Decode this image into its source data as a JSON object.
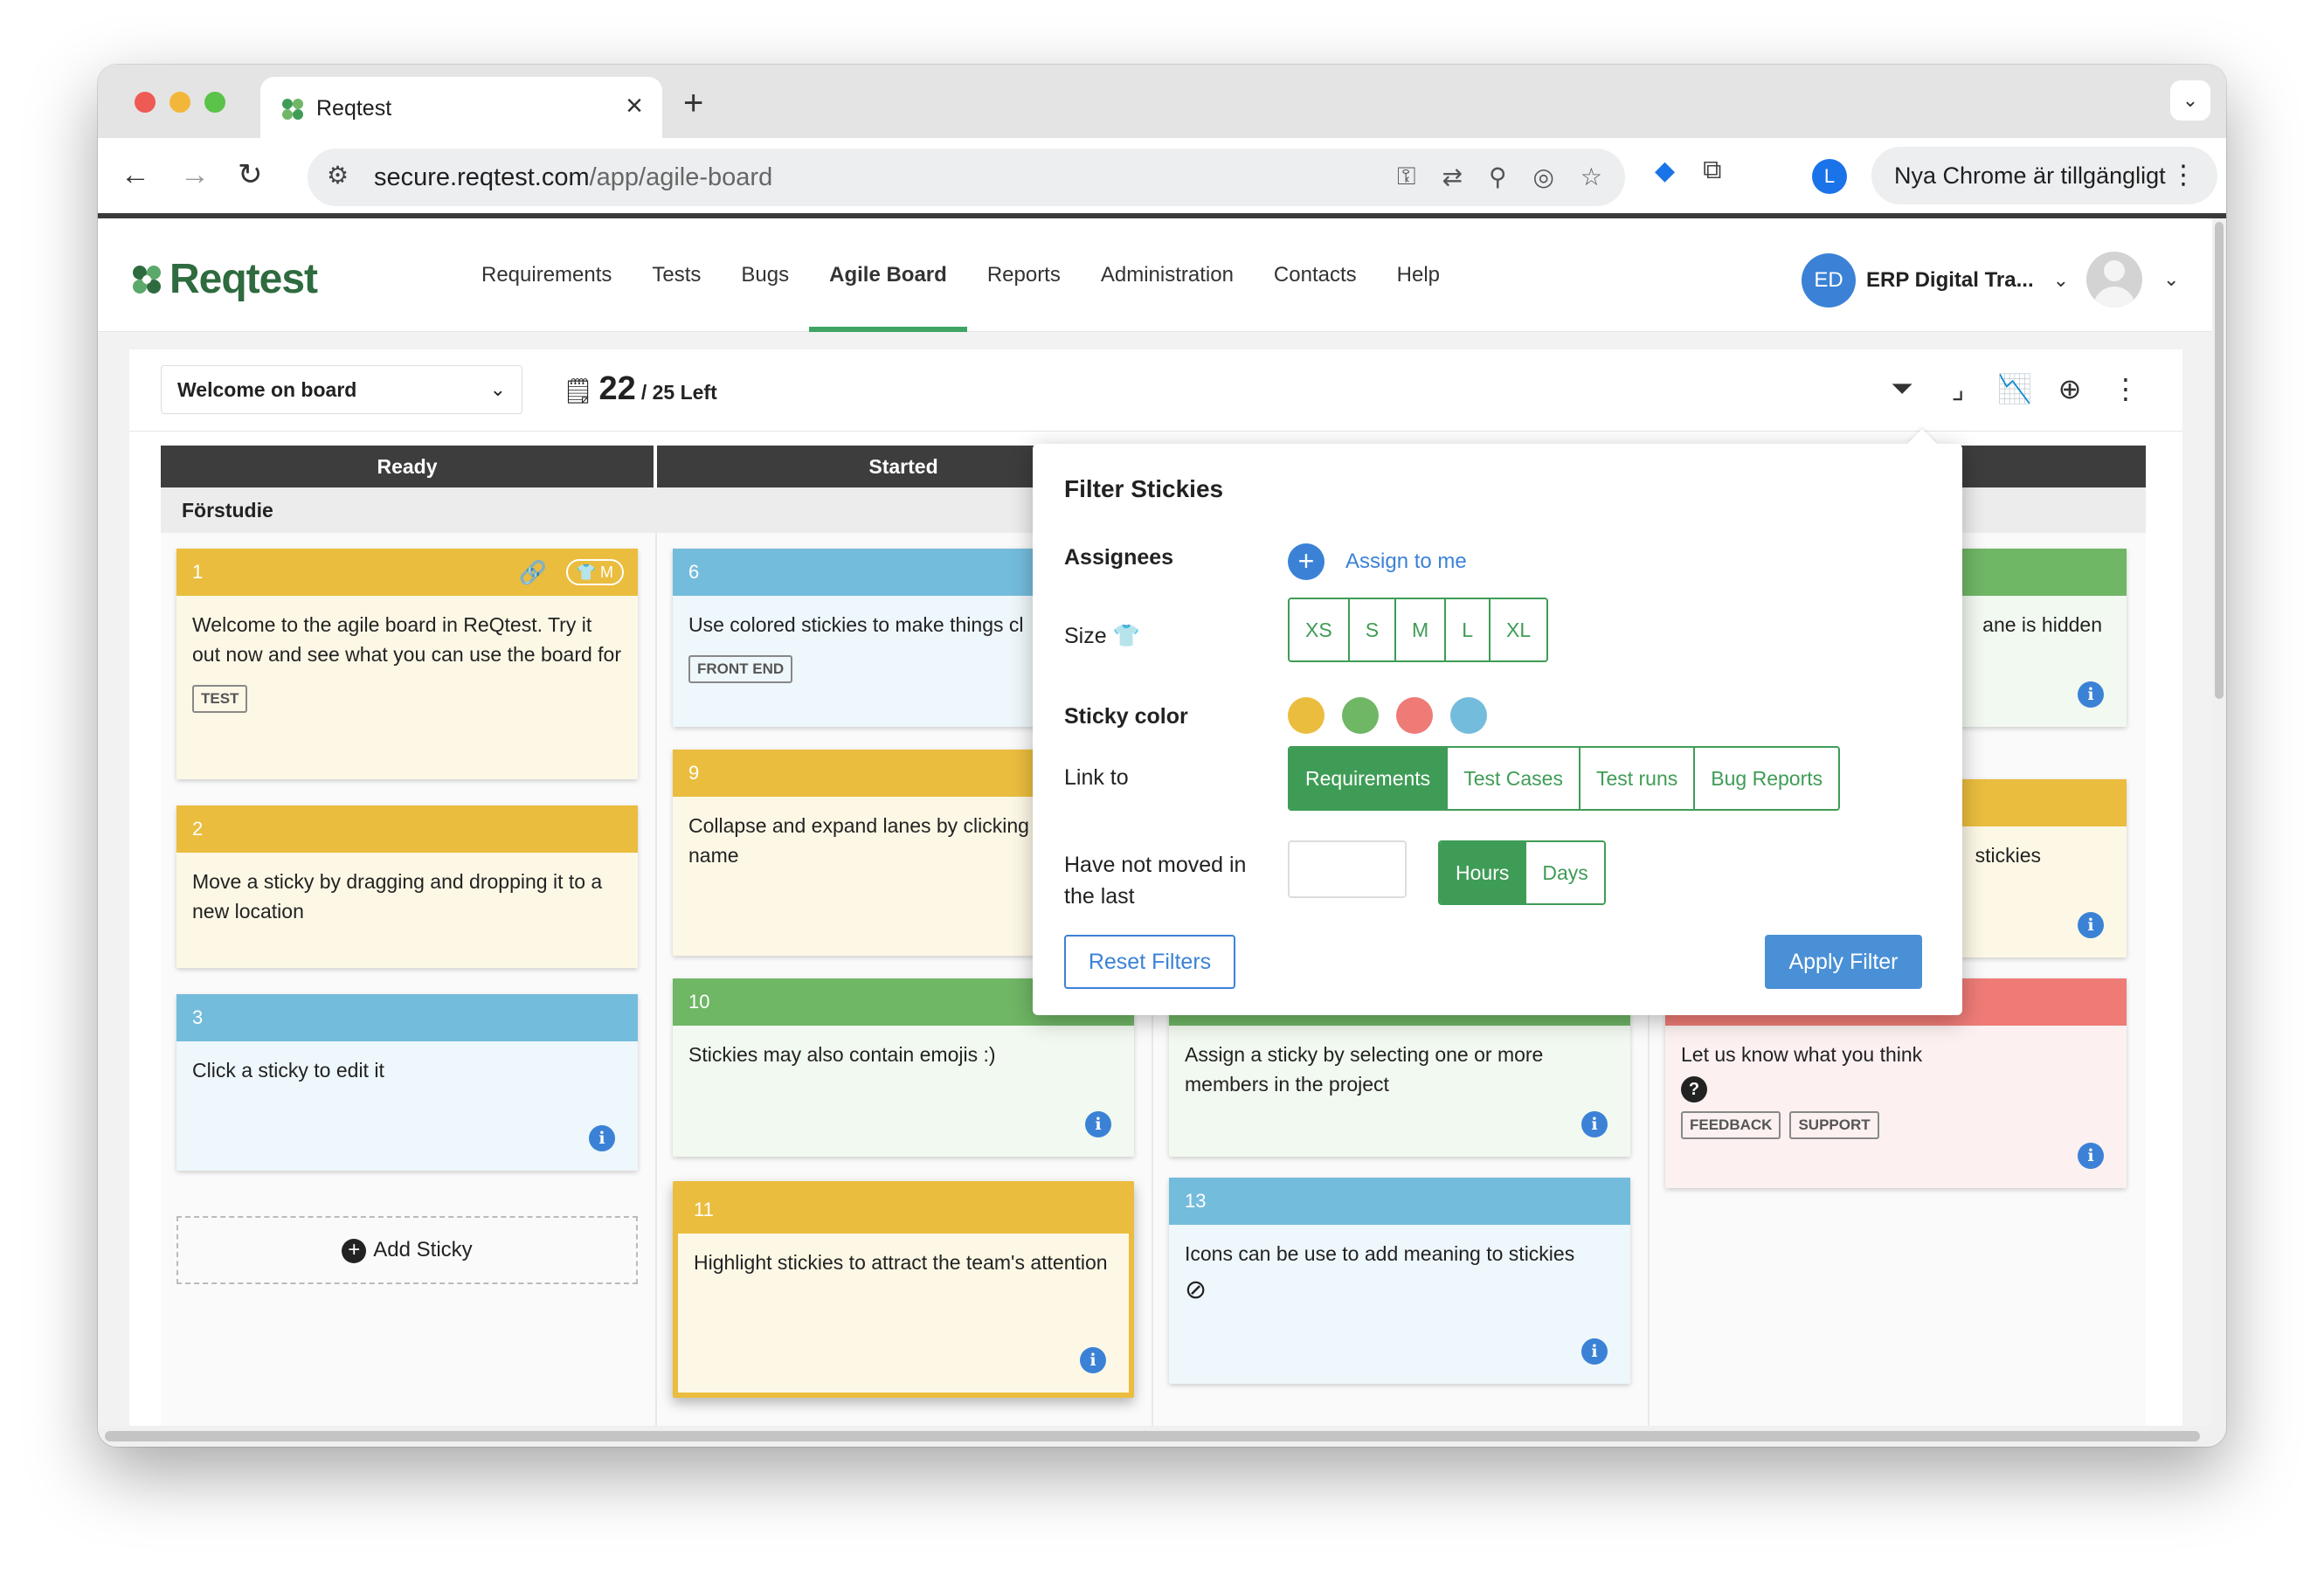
{
  "browser": {
    "tab_title": "Reqtest",
    "url_host": "secure.reqtest.com",
    "url_path": "/app/agile-board",
    "profile_initial": "L",
    "update_label": "Nya Chrome är tillgängligt"
  },
  "app": {
    "logo_text": "Reqtest",
    "nav": [
      "Requirements",
      "Tests",
      "Bugs",
      "Agile Board",
      "Reports",
      "Administration",
      "Contacts",
      "Help"
    ],
    "active_nav": "Agile Board",
    "workspace_initials": "ED",
    "workspace_name": "ERP Digital Tra..."
  },
  "board": {
    "selected_board": "Welcome on board",
    "count_used": "22",
    "count_left": "/ 25 Left",
    "lanes": [
      "Ready",
      "Started"
    ],
    "swimlane": "Förstudie",
    "add_sticky_label": "Add Sticky"
  },
  "stickies": {
    "s1": {
      "num": "1",
      "text": "Welcome to the agile board in ReQtest. Try it out now and see what you can use the board for",
      "tags": [
        "TEST"
      ],
      "size": "M"
    },
    "s2": {
      "num": "2",
      "text": "Move a sticky by dragging and dropping it to a new location"
    },
    "s3": {
      "num": "3",
      "text": "Click a sticky to edit it"
    },
    "s6": {
      "num": "6",
      "text": "Use colored stickies to make things cl",
      "tags": [
        "FRONT END"
      ]
    },
    "s9": {
      "num": "9",
      "text": "Collapse and expand lanes by clicking row name"
    },
    "s10": {
      "num": "10",
      "text": "Stickies may also contain emojis :)"
    },
    "s11": {
      "num": "11",
      "text": "Highlight stickies to attract the team's attention"
    },
    "s12": {
      "text": "Assign a sticky by selecting one or more members in the project"
    },
    "s13": {
      "num": "13",
      "text": "Icons can be use to add meaning to stickies"
    },
    "r1": {
      "text": "ane is hidden"
    },
    "r2": {
      "text": "stickies"
    },
    "r3": {
      "text": "Let us know what you think",
      "tags": [
        "FEEDBACK",
        "SUPPORT"
      ]
    }
  },
  "filter": {
    "title": "Filter Stickies",
    "assignees_label": "Assignees",
    "assign_me": "Assign to me",
    "size_label": "Size",
    "sizes": [
      "XS",
      "S",
      "M",
      "L",
      "XL"
    ],
    "color_label": "Sticky color",
    "colors": [
      "#ebbd3e",
      "#6fb665",
      "#ee7b76",
      "#74bcdc"
    ],
    "link_label": "Link to",
    "link_options": [
      "Requirements",
      "Test Cases",
      "Test runs",
      "Bug Reports"
    ],
    "link_selected": "Requirements",
    "moved_label_1": "Have not moved in",
    "moved_label_2": "the last",
    "moved_value": "",
    "unit_options": [
      "Hours",
      "Days"
    ],
    "unit_selected": "Hours",
    "reset_label": "Reset Filters",
    "apply_label": "Apply Filter"
  }
}
